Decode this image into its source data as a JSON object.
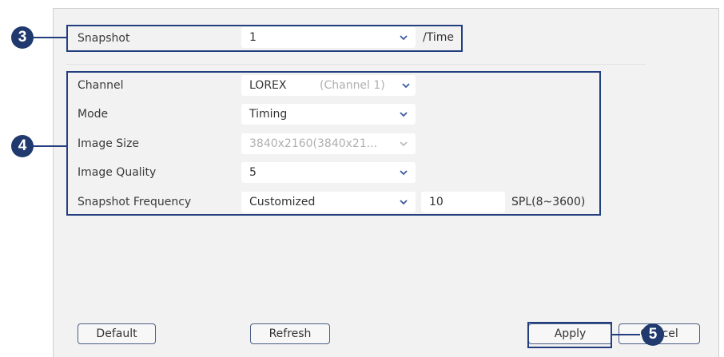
{
  "snapshot": {
    "label": "Snapshot",
    "value": "1",
    "unit": "/Time"
  },
  "fields": {
    "channel": {
      "label": "Channel",
      "value": "LOREX",
      "hint": "(Channel 1)"
    },
    "mode": {
      "label": "Mode",
      "value": "Timing"
    },
    "image_size": {
      "label": "Image Size",
      "value": "3840x2160(3840x21..."
    },
    "image_quality": {
      "label": "Image Quality",
      "value": "5"
    },
    "snapshot_frequency": {
      "label": "Snapshot Frequency",
      "value": "Customized",
      "input_value": "10",
      "unit": "SPL(8~3600)"
    }
  },
  "buttons": {
    "default": "Default",
    "refresh": "Refresh",
    "apply": "Apply",
    "cancel": "Cancel"
  },
  "callouts": {
    "three": "3",
    "four": "4",
    "five": "5"
  },
  "colors": {
    "highlight": "#233f80",
    "callout_bg": "#20396e",
    "panel_bg": "#f2f2f2",
    "field_bg": "#ffffff"
  }
}
